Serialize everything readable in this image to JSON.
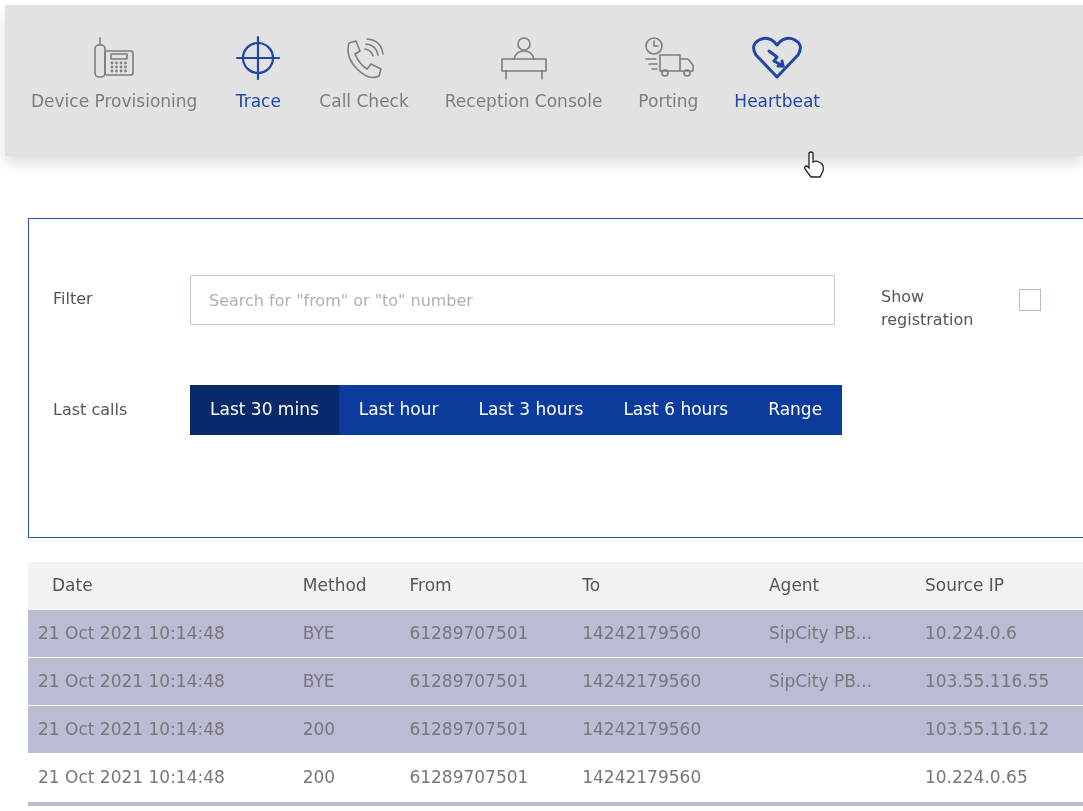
{
  "nav": [
    {
      "label": "Device Provisioning",
      "kind": "desk-phone",
      "highlighted": false
    },
    {
      "label": "Trace",
      "kind": "crosshair",
      "highlighted": true
    },
    {
      "label": "Call Check",
      "kind": "phone-ringing",
      "highlighted": false
    },
    {
      "label": "Reception Console",
      "kind": "receptionist",
      "highlighted": false
    },
    {
      "label": "Porting",
      "kind": "delivery-truck",
      "highlighted": false
    },
    {
      "label": "Heartbeat",
      "kind": "heart",
      "highlighted": true
    }
  ],
  "filter": {
    "label": "Filter",
    "placeholder": "Search for \"from\" or \"to\" number",
    "toggle_label": "Show registration",
    "checked": false
  },
  "last_calls": {
    "label": "Last calls",
    "options": [
      {
        "label": "Last 30 mins",
        "selected": true
      },
      {
        "label": "Last hour",
        "selected": false
      },
      {
        "label": "Last 3 hours",
        "selected": false
      },
      {
        "label": "Last 6 hours",
        "selected": false
      },
      {
        "label": "Range",
        "selected": false
      }
    ]
  },
  "table": {
    "columns": [
      "Date",
      "Method",
      "From",
      "To",
      "Agent",
      "Source IP"
    ],
    "rows": [
      {
        "cells": [
          "21 Oct 2021 10:14:48",
          "BYE",
          "61289707501",
          "14242179560",
          "SipCity PB...",
          "10.224.0.6"
        ],
        "selected": true
      },
      {
        "cells": [
          "21 Oct 2021 10:14:48",
          "BYE",
          "61289707501",
          "14242179560",
          "SipCity PB...",
          "103.55.116.55"
        ],
        "selected": true
      },
      {
        "cells": [
          "21 Oct 2021 10:14:48",
          "200",
          "61289707501",
          "14242179560",
          "",
          "103.55.116.12"
        ],
        "selected": true
      },
      {
        "cells": [
          "21 Oct 2021 10:14:48",
          "200",
          "61289707501",
          "14242179560",
          "",
          "10.224.0.65"
        ],
        "selected": false
      }
    ]
  }
}
